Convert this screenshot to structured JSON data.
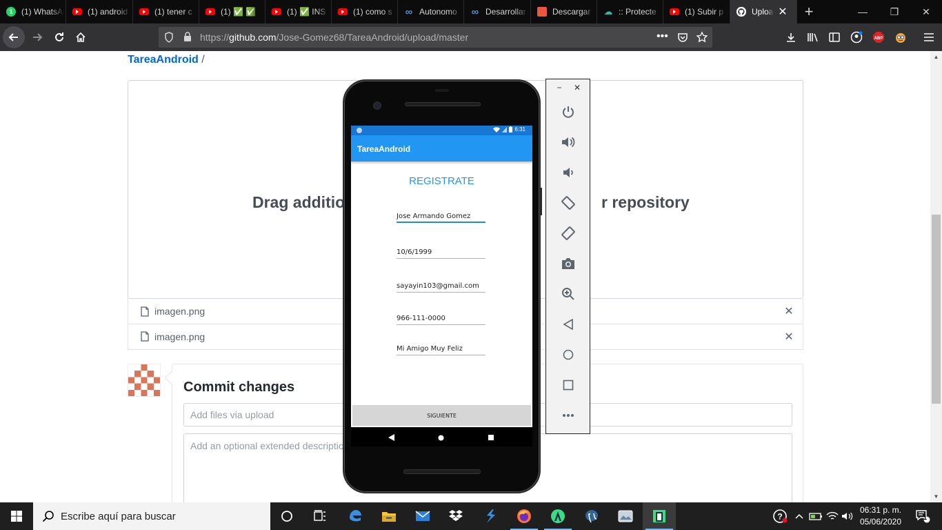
{
  "browser": {
    "tabs": [
      {
        "label": "(1) WhatsApp",
        "icon": "whatsapp-icon"
      },
      {
        "label": "(1) android studio",
        "icon": "youtube-icon"
      },
      {
        "label": "(1) tener c",
        "icon": "youtube-icon"
      },
      {
        "label": "(1) ✅ ✅",
        "icon": "youtube-icon"
      },
      {
        "label": "(1) ✅ INS",
        "icon": "youtube-icon"
      },
      {
        "label": "(1) como s",
        "icon": "youtube-icon"
      },
      {
        "label": "Autonomo",
        "icon": "infinity-icon"
      },
      {
        "label": "Desarrollar",
        "icon": "infinity-icon"
      },
      {
        "label": "Descargar",
        "icon": "download-site-icon"
      },
      {
        "label": ":: Protecte",
        "icon": "cloud-icon"
      },
      {
        "label": "(1) Subir p",
        "icon": "youtube-icon"
      },
      {
        "label": "Upload",
        "icon": "github-icon"
      }
    ],
    "url_prefix": "https://",
    "url_host": "github.com",
    "url_path": "/Jose-Gomez68/TareaAndroid/upload/master"
  },
  "page": {
    "breadcrumb_repo": "TareaAndroid",
    "breadcrumb_sep": " /",
    "drop_text_left": "Drag additio",
    "drop_text_right": "r repository",
    "files": [
      {
        "name": "imagen.png"
      },
      {
        "name": "imagen.png"
      }
    ],
    "commit_title": "Commit changes",
    "commit_summary_placeholder": "Add files via upload",
    "commit_desc_placeholder": "Add an optional extended description"
  },
  "emulator": {
    "status_time": "6:31",
    "app_title": "TareaAndroid",
    "heading": "REGISTRATE",
    "fields": [
      {
        "value": "Jose Armando Gomez"
      },
      {
        "value": "10/6/1999"
      },
      {
        "value": "sayayin103@gmail.com"
      },
      {
        "value": "966-111-0000"
      },
      {
        "value": "Mi Amigo Muy Feliz"
      }
    ],
    "next_button": "SIGUIENTE"
  },
  "taskbar": {
    "search_placeholder": "Escribe aquí para buscar",
    "time": "06:31 p. m.",
    "date": "05/06/2020",
    "notification_count": "1"
  },
  "colors": {
    "github_link": "#0366d6",
    "android_appbar": "#2196f3",
    "android_statusbar": "#1976d2",
    "firefox_chrome": "#323234"
  }
}
